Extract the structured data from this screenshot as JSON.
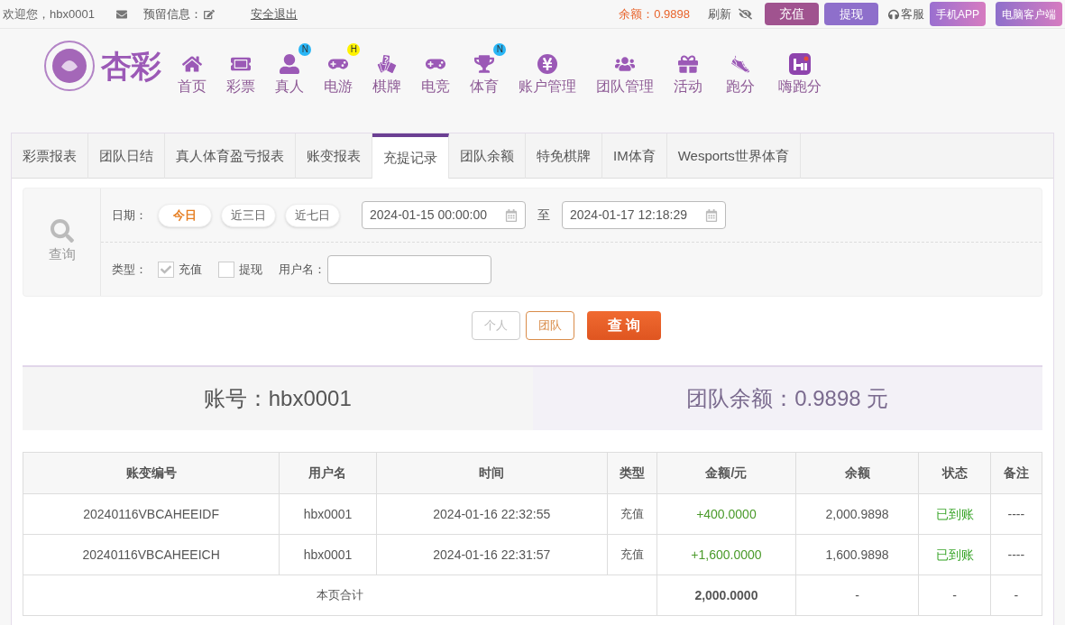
{
  "top_bar": {
    "welcome": "欢迎您，hbx0001",
    "message_label": "预留信息：",
    "logout": "安全退出",
    "balance": "余额：0.9898",
    "refresh": "刷新",
    "deposit": "充值",
    "withdraw": "提现",
    "service": "客服",
    "mobile_app": "手机APP",
    "pc_client": "电脑客户端"
  },
  "logo": {
    "text": "杏彩"
  },
  "nav": [
    {
      "kind": "home",
      "label": "首页"
    },
    {
      "kind": "ticket",
      "label": "彩票"
    },
    {
      "kind": "live",
      "label": "真人",
      "badge": "N"
    },
    {
      "kind": "gamepad",
      "label": "电游",
      "badge": "H"
    },
    {
      "kind": "cards",
      "label": "棋牌"
    },
    {
      "kind": "gamepad",
      "label": "电竞"
    },
    {
      "kind": "trophy",
      "label": "体育",
      "badge": "N"
    },
    {
      "kind": "coin",
      "label": "账户管理"
    },
    {
      "kind": "team",
      "label": "团队管理"
    },
    {
      "kind": "gift",
      "label": "活动"
    },
    {
      "kind": "shoe",
      "label": "跑分"
    },
    {
      "kind": "hi",
      "label": "嗨跑分"
    }
  ],
  "tabs": [
    {
      "label": "彩票报表",
      "selected": false
    },
    {
      "label": "团队日结",
      "selected": false
    },
    {
      "label": "真人体育盈亏报表",
      "selected": false
    },
    {
      "label": "账变报表",
      "selected": false
    },
    {
      "label": "充提记录",
      "selected": true
    },
    {
      "label": "团队余额",
      "selected": false
    },
    {
      "label": "特免棋牌",
      "selected": false
    },
    {
      "label": "IM体育",
      "selected": false
    },
    {
      "label": "Wesports世界体育",
      "selected": false
    }
  ],
  "filter": {
    "search_label": "查询",
    "date_label": "日期：",
    "ranges": [
      {
        "label": "今日",
        "selected": true
      },
      {
        "label": "近三日",
        "selected": false
      },
      {
        "label": "近七日",
        "selected": false
      }
    ],
    "start": "2024-01-15 00:00:00",
    "to": "至",
    "end": "2024-01-17 12:18:29",
    "type_label": "类型：",
    "types": [
      {
        "label": "充值",
        "checked": true
      },
      {
        "label": "提现",
        "checked": false
      }
    ],
    "username_label": "用户名：",
    "scopes": [
      {
        "label": "个人",
        "selected": false
      },
      {
        "label": "团队",
        "selected": true
      }
    ],
    "query_button": "查 询"
  },
  "summary": {
    "account": "账号：hbx0001",
    "team_balance": "团队余额：0.9898 元"
  },
  "table": {
    "columns": [
      "账变编号",
      "用户名",
      "时间",
      "类型",
      "金额/元",
      "余额",
      "状态",
      "备注"
    ],
    "rows": [
      [
        "20240116VBCAHEEIDF",
        "hbx0001",
        "2024-01-16 22:32:55",
        "充值",
        "+400.0000",
        "2,000.9898",
        "已到账",
        "----"
      ],
      [
        "20240116VBCAHEEICH",
        "hbx0001",
        "2024-01-16 22:31:57",
        "充值",
        "+1,600.0000",
        "1,600.9898",
        "已到账",
        "----"
      ]
    ],
    "total": [
      "本页合计",
      "2,000.0000",
      "-",
      "-",
      "-"
    ]
  }
}
